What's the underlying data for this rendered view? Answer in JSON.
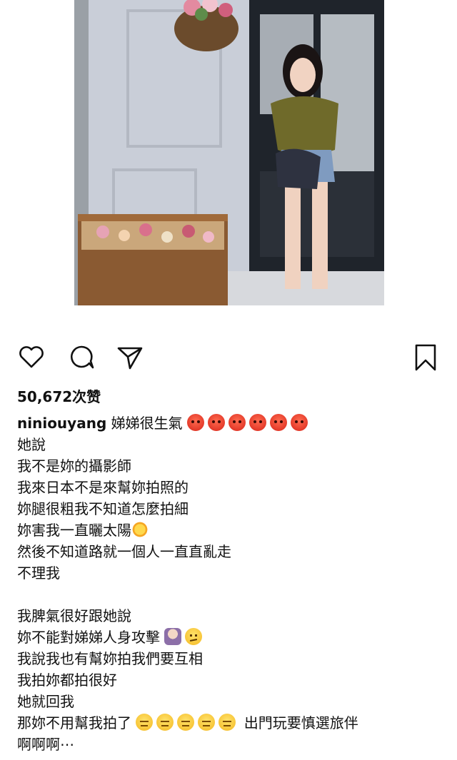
{
  "post": {
    "image_alt": "woman posing beside flower crate",
    "likes": "50,672次赞",
    "username": "niniouyang",
    "caption_lines": [
      "娣娣很生氣",
      "她說",
      "我不是妳的攝影師",
      "我來日本不是來幫妳拍照的",
      "妳腿很粗我不知道怎麼拍細",
      "妳害我一直曬太陽",
      "然後不知道路就一個人一直直亂走",
      "不理我",
      "",
      "我脾氣很好跟她說",
      "妳不能對娣娣人身攻擊",
      "我說我也有幫妳拍我們要互相",
      "我拍妳都拍很好",
      "她就回我",
      "那妳不用幫我拍了",
      "出門玩要慎選旅伴",
      "啊啊啊⋯"
    ]
  },
  "icons": {
    "like": "heart-icon",
    "comment": "comment-bubble-icon",
    "share": "paper-plane-icon",
    "save": "bookmark-icon"
  },
  "colors": {
    "text": "#111111",
    "background": "#ffffff"
  }
}
